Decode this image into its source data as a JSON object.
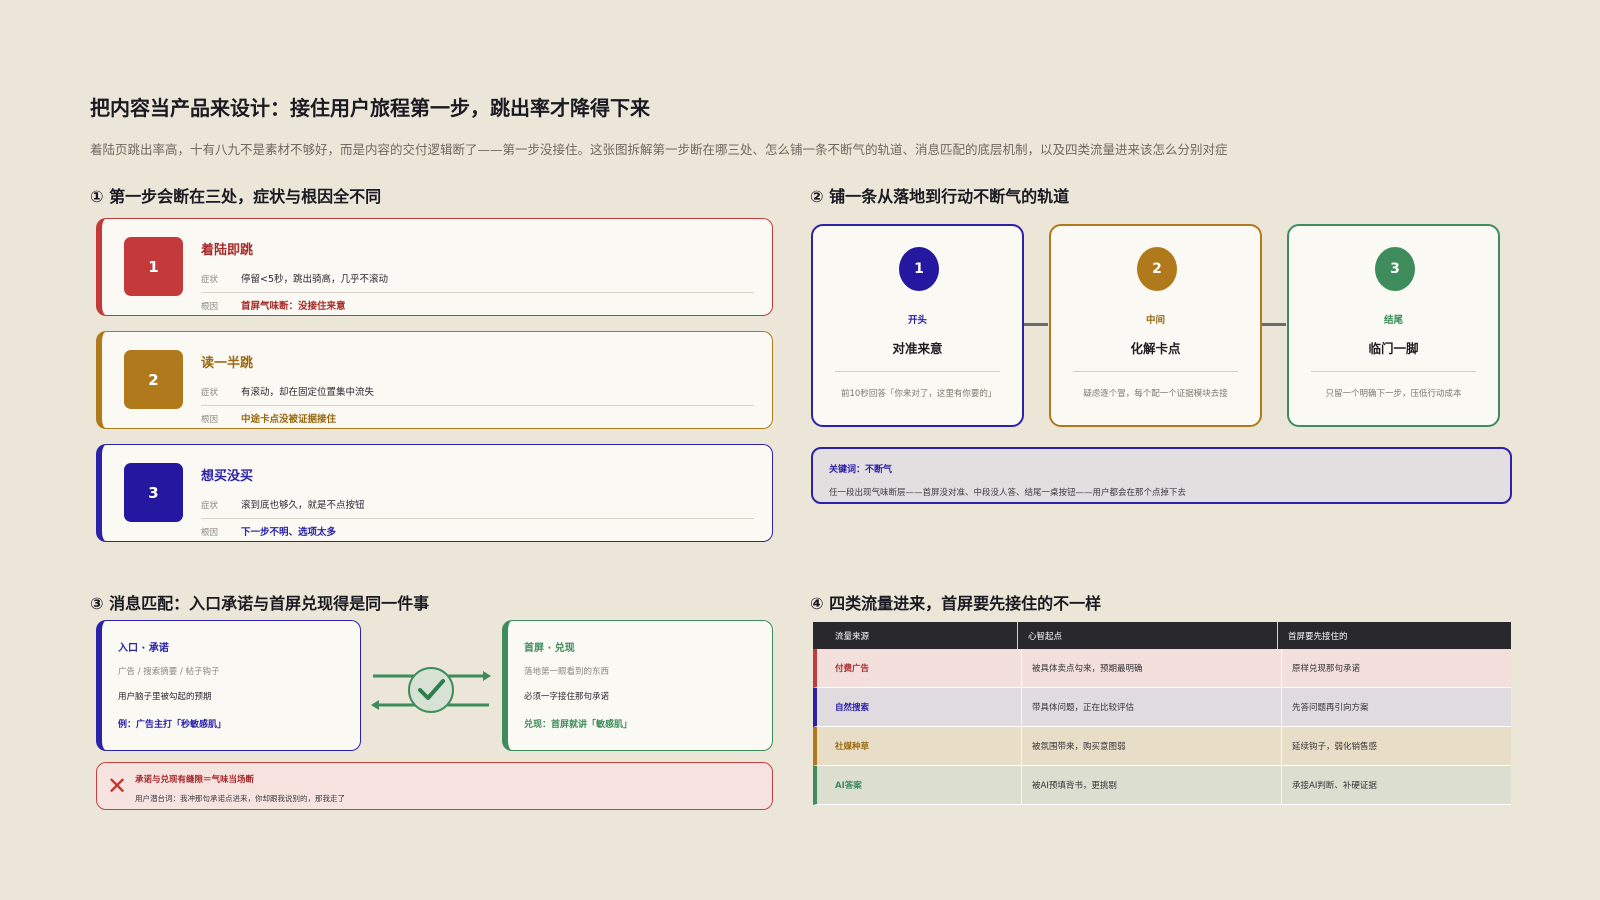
{
  "title": "把内容当产品来设计：接住用户旅程第一步，跳出率才降得下来",
  "subtitle": "着陆页跳出率高，十有八九不是素材不够好，而是内容的交付逻辑断了——第一步没接住。这张图拆解第一步断在哪三处、怎么铺一条不断气的轨道、消息匹配的底层机制，以及四类流量进来该怎么分别对症",
  "colors": {
    "red": "#c43a3a",
    "gold": "#b07a1c",
    "navy": "#2b22a8",
    "green": "#3e8c5c",
    "dark": "#28282d"
  },
  "section1": {
    "heading": "① 第一步会断在三处，症状与根因全不同",
    "symptom_label": "症状",
    "root_label": "根因",
    "cards": [
      {
        "num": "1",
        "name": "着陆即跳",
        "symptom": "停留<5秒，跳出骑高，几乎不滚动",
        "root": "首屏气味断：没接住来意"
      },
      {
        "num": "2",
        "name": "读一半跳",
        "symptom": "有滚动，却在固定位置集中流失",
        "root": "中途卡点没被证据接住"
      },
      {
        "num": "3",
        "name": "想买没买",
        "symptom": "滚到底也够久，就是不点按钮",
        "root": "下一步不明、选项太多"
      }
    ]
  },
  "section2": {
    "heading": "② 铺一条从落地到行动不断气的轨道",
    "stages": [
      {
        "num": "1",
        "stage": "开头",
        "name": "对准来意",
        "desc": "前10秒回答「你来对了，这里有你要的」"
      },
      {
        "num": "2",
        "stage": "中间",
        "name": "化解卡点",
        "desc": "疑虑逐个冒，每个配一个证据模块去接"
      },
      {
        "num": "3",
        "stage": "结尾",
        "name": "临门一脚",
        "desc": "只留一个明确下一步，压低行动成本"
      }
    ],
    "keynote_title": "关键词：不断气",
    "keynote_desc": "任一段出现气味断层——首屏没对准、中段没人答、结尾一桌按钮——用户都会在那个点掉下去"
  },
  "section3": {
    "heading": "③ 消息匹配：入口承诺与首屏兑现得是同一件事",
    "left": {
      "head": "入口 · 承诺",
      "channels": "广告 / 搜索摘要 / 帖子钩子",
      "desc": "用户脑子里被勾起的预期",
      "example": "例：广告主打「秒敏感肌」"
    },
    "right": {
      "head": "首屏 · 兑现",
      "channels": "落地第一眼看到的东西",
      "desc": "必须一字接住那句承诺",
      "example": "兑现：首屏就讲「敏感肌」"
    },
    "warning_title": "承诺与兑现有缝隙＝气味当场断",
    "warning_desc": "用户潜台词：我冲那句承诺点进来，你却跟我说别的，那我走了"
  },
  "section4": {
    "heading": "④ 四类流量进来，首屏要先接住的不一样",
    "columns": [
      "流量来源",
      "心智起点",
      "首屏要先接住的"
    ],
    "rows": [
      {
        "source": "付费广告",
        "mind": "被具体卖点勾来，预期最明确",
        "first": "原样兑现那句承诺"
      },
      {
        "source": "自然搜索",
        "mind": "带具体问题，正在比较评估",
        "first": "先答问题再引向方案"
      },
      {
        "source": "社媒种草",
        "mind": "被氛围带来，购买意图弱",
        "first": "延续钩子，弱化销售感"
      },
      {
        "source": "AI答案",
        "mind": "被AI预填背书，更挑剔",
        "first": "承接AI判断、补硬证据"
      }
    ]
  }
}
